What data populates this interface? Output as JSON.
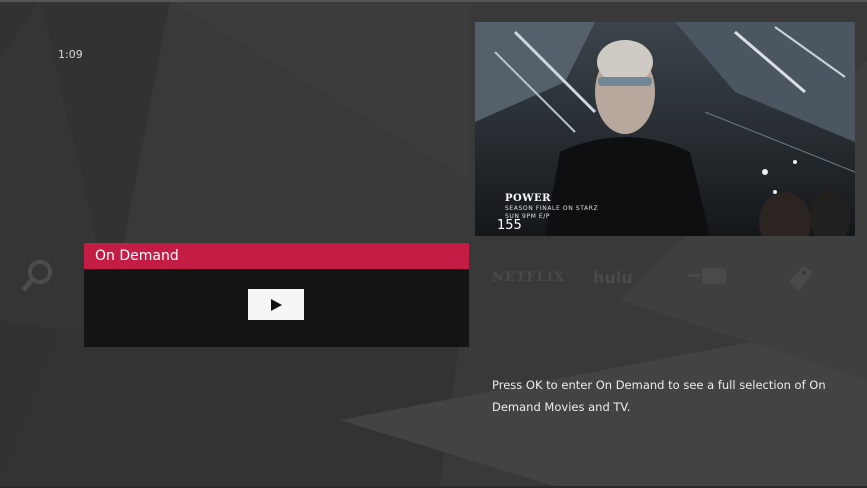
{
  "clock": "1:09",
  "preview": {
    "show_title": "POWER",
    "line1": "SEASON FINALE  ON STARZ",
    "line2": "SUN 9PM E/P",
    "channel": "155"
  },
  "ondemand": {
    "title": "On Demand",
    "play_icon": "play-icon"
  },
  "apps": {
    "netflix": "NETFLIX",
    "hulu": "hulu",
    "youtube": "YouTube"
  },
  "description": "Press OK to enter On Demand to see a full selection of On Demand Movies and TV.",
  "colors": {
    "background": "#3a3939",
    "accent": "#c41d45",
    "panel": "#141414"
  }
}
